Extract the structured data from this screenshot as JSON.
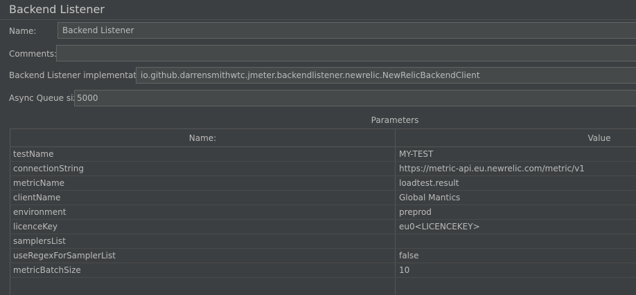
{
  "panel": {
    "title": "Backend Listener"
  },
  "form": {
    "name_label": "Name:",
    "name_value": "Backend Listener",
    "comments_label": "Comments:",
    "comments_value": "",
    "impl_label": "Backend Listener implementation",
    "impl_value": "io.github.darrensmithwtc.jmeter.backendlistener.newrelic.NewRelicBackendClient",
    "queue_label": "Async Queue size",
    "queue_value": "5000"
  },
  "parameters": {
    "title": "Parameters",
    "columns": [
      "Name:",
      "Value"
    ],
    "rows": [
      {
        "name": "testName",
        "value": "MY-TEST"
      },
      {
        "name": "connectionString",
        "value": "https://metric-api.eu.newrelic.com/metric/v1"
      },
      {
        "name": "metricName",
        "value": "loadtest.result"
      },
      {
        "name": "clientName",
        "value": "Global Mantics"
      },
      {
        "name": "environment",
        "value": "preprod"
      },
      {
        "name": "licenceKey",
        "value": "eu0<LICENCEKEY>"
      },
      {
        "name": "samplersList",
        "value": ""
      },
      {
        "name": "useRegexForSamplerList",
        "value": "false"
      },
      {
        "name": "metricBatchSize",
        "value": "10"
      }
    ]
  },
  "colors": {
    "background": "#3c3f41",
    "field_background": "#45494a",
    "border": "#646464",
    "text": "#bbbbbb"
  }
}
